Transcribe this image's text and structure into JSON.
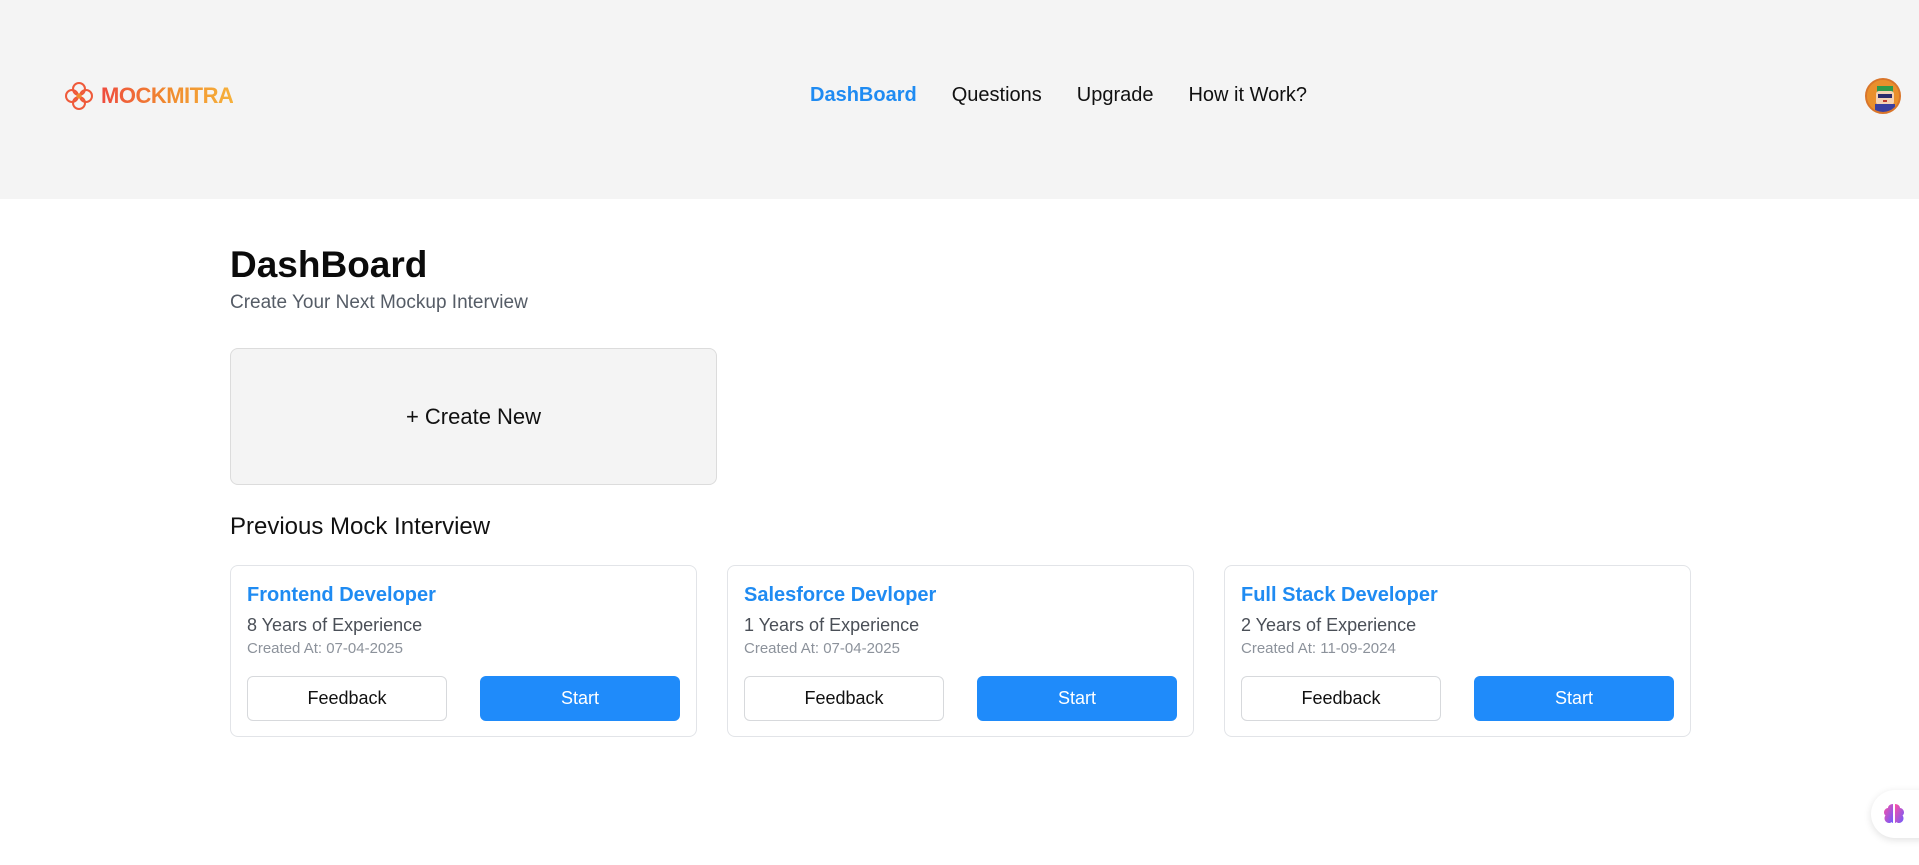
{
  "header": {
    "logo_text": "MOCKMITRA",
    "nav": [
      {
        "label": "DashBoard",
        "active": true
      },
      {
        "label": "Questions",
        "active": false
      },
      {
        "label": "Upgrade",
        "active": false
      },
      {
        "label": "How it Work?",
        "active": false
      }
    ],
    "avatar_icon": "user-avatar-icon"
  },
  "main": {
    "title": "DashBoard",
    "subtitle": "Create Your Next Mockup Interview",
    "create_label": "+ Create New",
    "previous_title": "Previous Mock Interview",
    "interviews": [
      {
        "role": "Frontend Developer",
        "experience": "8 Years of Experience",
        "created": "Created At: 07-04-2025",
        "feedback_label": "Feedback",
        "start_label": "Start"
      },
      {
        "role": "Salesforce Devloper",
        "experience": "1 Years of Experience",
        "created": "Created At: 07-04-2025",
        "feedback_label": "Feedback",
        "start_label": "Start"
      },
      {
        "role": "Full Stack Developer",
        "experience": "2 Years of Experience",
        "created": "Created At: 11-09-2024",
        "feedback_label": "Feedback",
        "start_label": "Start"
      }
    ]
  },
  "colors": {
    "accent": "#1f8bf2",
    "header_bg": "#f4f4f4",
    "brand_gradient": [
      "#ef4b3f",
      "#f6b13b"
    ]
  },
  "floating_widget_icon": "brain-icon"
}
